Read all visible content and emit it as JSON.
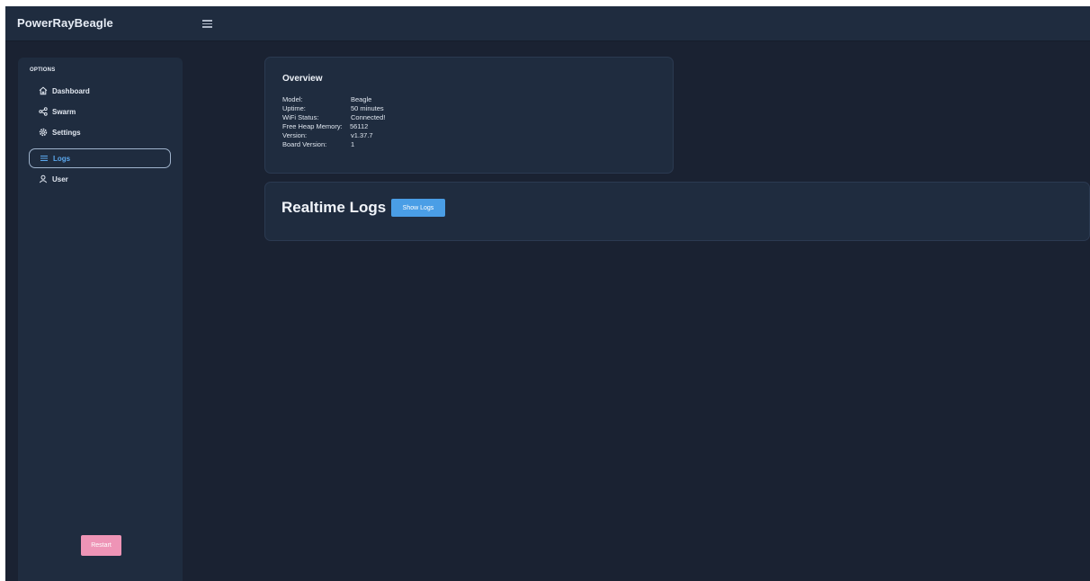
{
  "app": {
    "title": "PowerRayBeagle"
  },
  "sidebar": {
    "heading": "OPTIONS",
    "items": [
      {
        "label": "Dashboard",
        "icon": "home-icon",
        "active": false
      },
      {
        "label": "Swarm",
        "icon": "share-icon",
        "active": false
      },
      {
        "label": "Settings",
        "icon": "gear-icon",
        "active": false
      },
      {
        "label": "Logs",
        "icon": "list-icon",
        "active": true
      },
      {
        "label": "User",
        "icon": "user-icon",
        "active": false
      }
    ],
    "restart_label": "Restart"
  },
  "overview": {
    "title": "Overview",
    "rows": [
      {
        "label": "Model:",
        "value": "Beagle"
      },
      {
        "label": "Uptime:",
        "value": "50 minutes"
      },
      {
        "label": "WiFi Status:",
        "value": "Connected!"
      },
      {
        "label": "Free Heap Memory:",
        "value": "56112"
      },
      {
        "label": "Version:",
        "value": "v1.37.7"
      },
      {
        "label": "Board Version:",
        "value": "1"
      }
    ]
  },
  "realtime": {
    "title": "Realtime Logs",
    "button_label": "Show Logs"
  },
  "colors": {
    "background": "#1a2232",
    "panel": "#1f2c3f",
    "active_text": "#5ba8ee",
    "restart_button": "#ee94b6",
    "show_logs_button": "#4a9ee6"
  }
}
